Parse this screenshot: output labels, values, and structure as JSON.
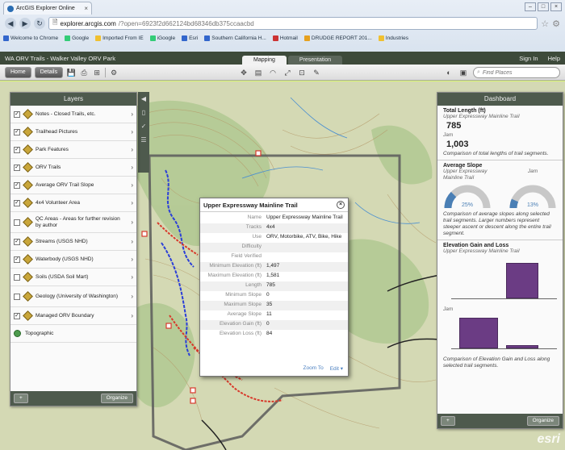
{
  "browser": {
    "tab_title": "ArcGIS Explorer Online",
    "url_host": "explorer.arcgis.com",
    "url_path": "/?open=6923f2d662124bd68346db375ccaacbd",
    "bookmarks": [
      "Welcome to Chrome",
      "Google",
      "Imported From IE",
      "iGoogle",
      "Esri",
      "Southern California H...",
      "Hotmail",
      "DRUDGE REPORT 201...",
      "Industries"
    ]
  },
  "app": {
    "title": "WA ORV Trails - Walker Valley ORV Park",
    "tabs": [
      "Mapping",
      "Presentation"
    ],
    "active_tab": "Mapping",
    "sign_in": "Sign In",
    "help": "Help"
  },
  "toolbar": {
    "home": "Home",
    "details": "Details",
    "search_placeholder": "Find Places"
  },
  "layers": {
    "title": "Layers",
    "items": [
      {
        "label": "Notes - Closed Trails, etc.",
        "checked": true
      },
      {
        "label": "Trailhead Pictures",
        "checked": true
      },
      {
        "label": "Park Features",
        "checked": true
      },
      {
        "label": "ORV Trails",
        "checked": true
      },
      {
        "label": "Average ORV Trail Slope",
        "checked": true
      },
      {
        "label": "4x4 Volunteer Area",
        "checked": true
      },
      {
        "label": "QC Areas - Areas for further revision by author",
        "checked": false
      },
      {
        "label": "Streams (USGS NHD)",
        "checked": true
      },
      {
        "label": "Waterbody (USGS NHD)",
        "checked": true
      },
      {
        "label": "Soils (USDA Soil Mart)",
        "checked": false
      },
      {
        "label": "Geology (University of Washington)",
        "checked": false
      },
      {
        "label": "Managed ORV Boundary",
        "checked": true
      }
    ],
    "basemap": "Topographic",
    "add_button": "+",
    "organize_button": "Organize"
  },
  "popup": {
    "title": "Upper Expressway Mainline Trail",
    "fields": [
      {
        "key": "Name",
        "value": "Upper Expressway Mainline Trail"
      },
      {
        "key": "Tracks",
        "value": "4x4"
      },
      {
        "key": "Use",
        "value": "ORV, Motorbike, ATV, Bike, Hike"
      },
      {
        "key": "Difficulty",
        "value": ""
      },
      {
        "key": "Field Verified",
        "value": ""
      },
      {
        "key": "Minimum Elevation (ft)",
        "value": "1,497"
      },
      {
        "key": "Maximum Elevation (ft)",
        "value": "1,581"
      },
      {
        "key": "Length",
        "value": "785"
      },
      {
        "key": "Minimum Slope",
        "value": "0"
      },
      {
        "key": "Maximum Slope",
        "value": "35"
      },
      {
        "key": "Average Slope",
        "value": "11"
      },
      {
        "key": "Elevation Gain (ft)",
        "value": "0"
      },
      {
        "key": "Elevation Loss (ft)",
        "value": "84"
      }
    ],
    "zoom_to": "Zoom To",
    "edit": "Edit"
  },
  "dashboard": {
    "title": "Dashboard",
    "total_length": {
      "title": "Total Length (ft)",
      "series1_name": "Upper Expressway Mainline Trail",
      "series1_value": "785",
      "series2_name": "Jam",
      "series2_value": "1,003",
      "note": "Comparison of total lengths of trail segments."
    },
    "average_slope": {
      "title": "Average Slope",
      "gauge1_name": "Upper Expressway Mainline Trail",
      "gauge1_value": "25%",
      "gauge1_fraction": 0.25,
      "gauge2_name": "Jam",
      "gauge2_value": "13%",
      "gauge2_fraction": 0.13,
      "note": "Comparison of average slopes along selected trail segments. Larger numbers represent steeper ascent or descent along the entire trail segment."
    },
    "elevation": {
      "title": "Elevation Gain and Loss",
      "series1_name": "Upper Expressway Mainline Trail",
      "series2_name": "Jam",
      "note": "Comparison of Elevation Gain and Loss along selected trail segments."
    },
    "add_button": "+",
    "organize_button": "Organize"
  },
  "map": {
    "watermark": "esri",
    "colors": {
      "boundary": "#555555",
      "trail_red": "#d8392b",
      "trail_blue": "#2b3fd8",
      "panel": "#4e5a4d",
      "chart_purple": "#6b3c84"
    }
  }
}
